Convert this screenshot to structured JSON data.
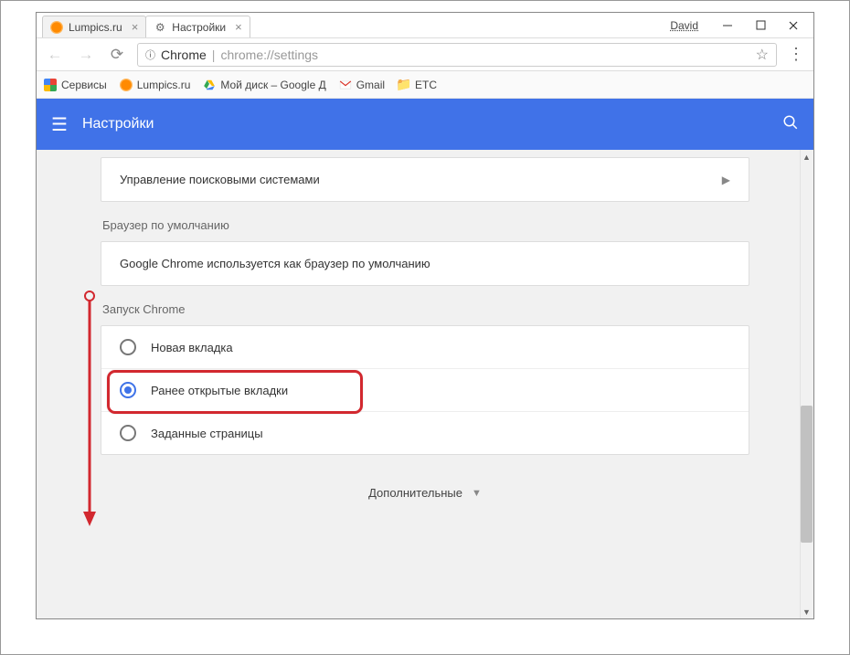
{
  "window": {
    "user_label": "David",
    "tabs": [
      {
        "title": "Lumpics.ru",
        "favicon": "orange",
        "active": false
      },
      {
        "title": "Настройки",
        "favicon": "gear",
        "active": true
      }
    ]
  },
  "addressbar": {
    "origin": "Chrome",
    "url": "chrome://settings"
  },
  "bookmarks": [
    {
      "label": "Сервисы",
      "icon": "apps"
    },
    {
      "label": "Lumpics.ru",
      "icon": "orange"
    },
    {
      "label": "Мой диск – Google Д",
      "icon": "drive"
    },
    {
      "label": "Gmail",
      "icon": "gmail"
    },
    {
      "label": "ETC",
      "icon": "folder"
    }
  ],
  "appbar": {
    "title": "Настройки"
  },
  "settings": {
    "search_engines_label": "Управление поисковыми системами",
    "default_browser_section": "Браузер по умолчанию",
    "default_browser_status": "Google Chrome используется как браузер по умолчанию",
    "on_startup_section": "Запуск Chrome",
    "startup_options": [
      {
        "label": "Новая вкладка",
        "checked": false
      },
      {
        "label": "Ранее открытые вкладки",
        "checked": true
      },
      {
        "label": "Заданные страницы",
        "checked": false
      }
    ],
    "advanced_label": "Дополнительные"
  }
}
